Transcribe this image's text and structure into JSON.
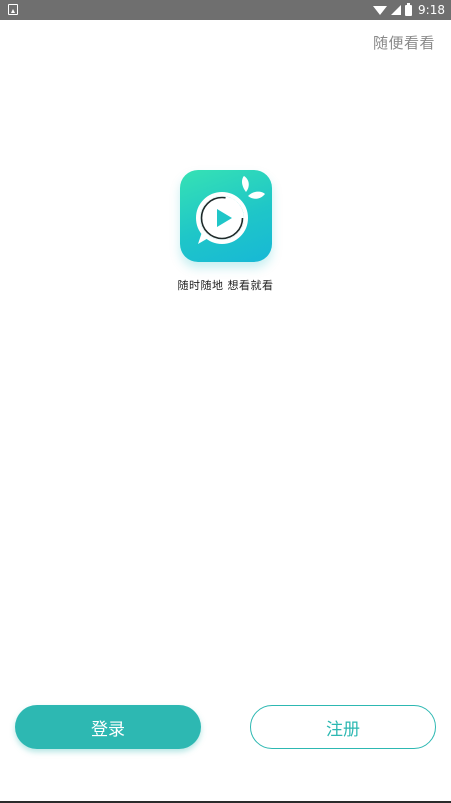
{
  "status_bar": {
    "time": "9:18",
    "icons": [
      "notification-icon",
      "wifi-icon",
      "signal-icon",
      "battery-icon"
    ]
  },
  "header": {
    "skip_label": "随便看看"
  },
  "brand": {
    "slogan": "随时随地 想看就看",
    "logo_icon": "play-bubble-logo"
  },
  "actions": {
    "login_label": "登录",
    "register_label": "注册"
  },
  "colors": {
    "accent": "#2db8b2",
    "status_bar": "#6f6f6f",
    "skip_text": "#8a8a8a"
  }
}
